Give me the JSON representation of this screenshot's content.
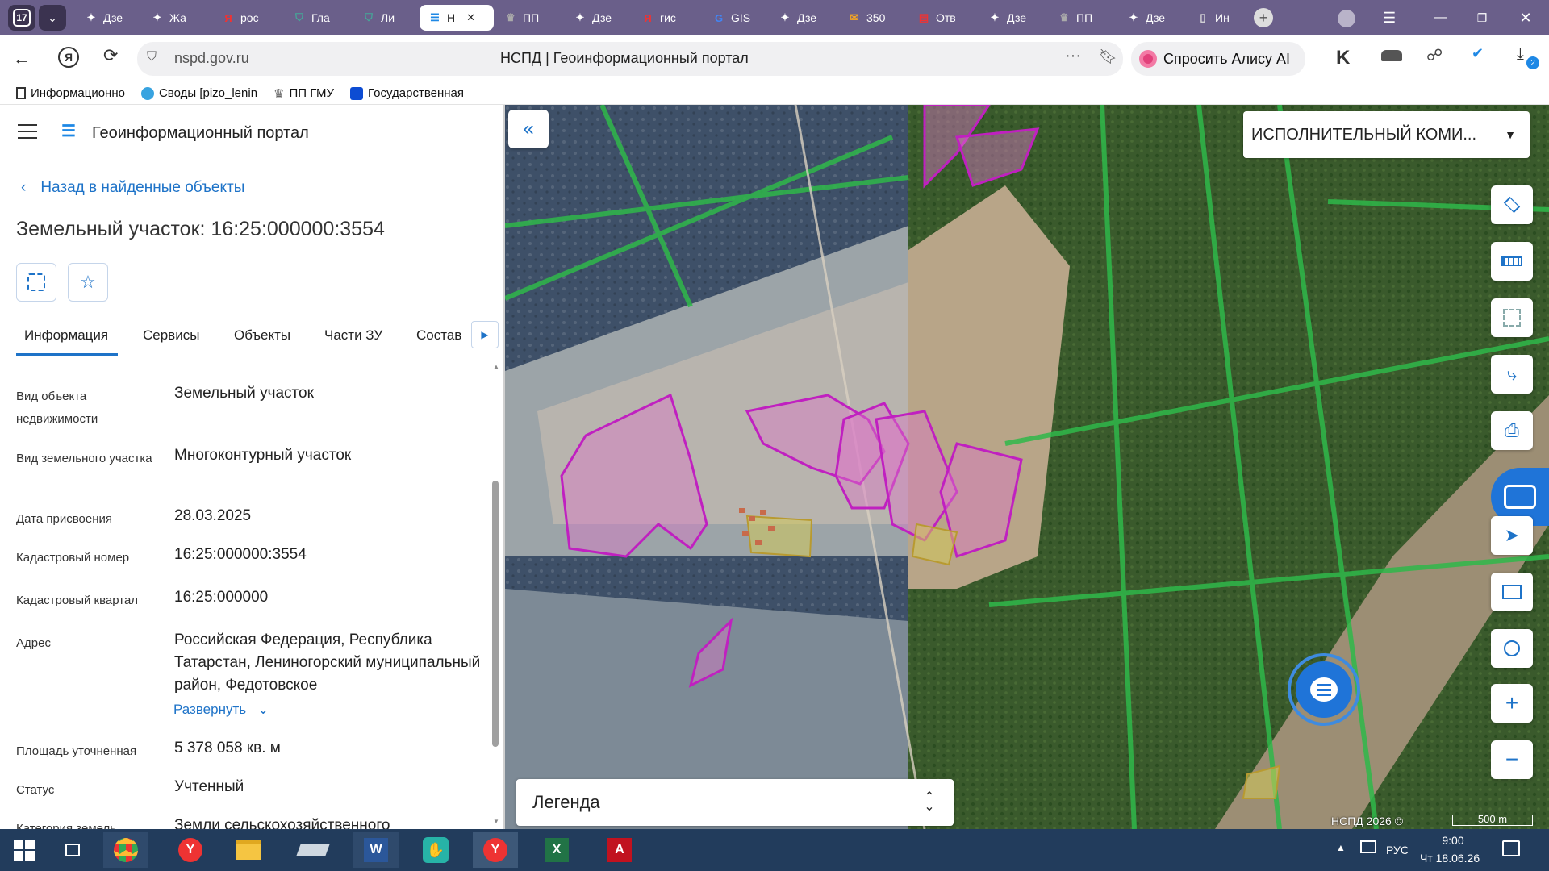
{
  "browser": {
    "tab_count": "17",
    "tabs": [
      {
        "label": "Дзе",
        "icon": "spark-icon"
      },
      {
        "label": "Жа",
        "icon": "spark-icon"
      },
      {
        "label": "рос",
        "icon": "yandex-icon"
      },
      {
        "label": "Гла",
        "icon": "shield-icon"
      },
      {
        "label": "Ли",
        "icon": "shield-icon"
      },
      {
        "label": "Н",
        "icon": "nspd-icon"
      },
      {
        "label": "ПП",
        "icon": "eagle-icon"
      },
      {
        "label": "Дзе",
        "icon": "spark-icon"
      },
      {
        "label": "гис",
        "icon": "yandex-icon"
      },
      {
        "label": "GIS",
        "icon": "g-icon"
      },
      {
        "label": "Дзе",
        "icon": "spark-icon"
      },
      {
        "label": "350",
        "icon": "mail-icon"
      },
      {
        "label": "Отв",
        "icon": "pdf-icon"
      },
      {
        "label": "Дзе",
        "icon": "spark-icon"
      },
      {
        "label": "ПП",
        "icon": "eagle-icon"
      },
      {
        "label": "Дзе",
        "icon": "spark-icon"
      },
      {
        "label": "Ин",
        "icon": "doc-icon"
      }
    ],
    "url": "nspd.gov.ru",
    "page_title": "НСПД | Геоинформационный портал",
    "alice_label": "Спросить Алису AI",
    "downloads_badge": "2",
    "bookmarks": [
      {
        "label": "Информационно"
      },
      {
        "label": "Своды [pizo_lenin"
      },
      {
        "label": "ПП ГМУ"
      },
      {
        "label": "Государственная"
      }
    ]
  },
  "portal": {
    "name": "Геоинформационный портал",
    "back_link": "Назад в найденные объекты",
    "object_title": "Земельный участок: 16:25:000000:3554",
    "tabs": [
      "Информация",
      "Сервисы",
      "Объекты",
      "Части ЗУ",
      "Состав"
    ],
    "fields": [
      {
        "label": "Вид объекта недвижимости",
        "value": "Земельный участок"
      },
      {
        "label": "Вид земельного участка",
        "value": "Многоконтурный участок"
      },
      {
        "label": "Дата присвоения",
        "value": "28.03.2025"
      },
      {
        "label": "Кадастровый номер",
        "value": "16:25:000000:3554"
      },
      {
        "label": "Кадастровый квартал",
        "value": "16:25:000000"
      },
      {
        "label": "Адрес",
        "value": "Российская Федерация, Республика Татарстан, Лениногорский муниципальный район, Федотовское"
      },
      {
        "label": "Площадь уточненная",
        "value": "5 378 058 кв. м"
      },
      {
        "label": "Статус",
        "value": "Учтенный"
      },
      {
        "label": "Категория земель",
        "value": "Земли сельскохозяйственного"
      }
    ],
    "expand_label": "Развернуть"
  },
  "map": {
    "layer_select": "ИСПОЛНИТЕЛЬНЫЙ КОМИ...",
    "legend": "Легенда",
    "copyright": "НСПД 2026 ©",
    "scale": "500 m"
  },
  "taskbar": {
    "lang": "РУС",
    "time": "9:00",
    "date": "Чт 18.06.26"
  }
}
